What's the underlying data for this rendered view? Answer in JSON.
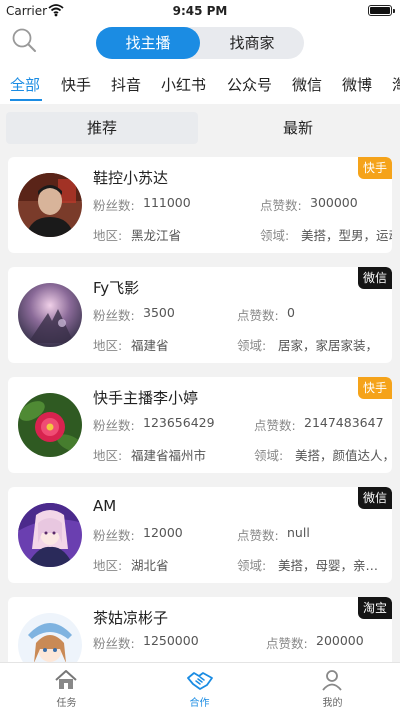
{
  "status_bar": {
    "carrier": "Carrier",
    "time": "9:45 PM"
  },
  "header": {
    "segment": [
      {
        "label": "找主播",
        "active": true
      },
      {
        "label": "找商家",
        "active": false
      }
    ]
  },
  "platform_tabs": [
    {
      "label": "全部",
      "active": true
    },
    {
      "label": "快手"
    },
    {
      "label": "抖音"
    },
    {
      "label": "小红书"
    },
    {
      "label": "公众号"
    },
    {
      "label": "微信"
    },
    {
      "label": "微博"
    },
    {
      "label": "淘"
    }
  ],
  "sort": {
    "recommend": "推荐",
    "newest": "最新"
  },
  "labels": {
    "fans": "粉丝数:",
    "likes": "点赞数:",
    "region": "地区:",
    "field": "领域:"
  },
  "cards": [
    {
      "name": "鞋控小苏达",
      "fans": "111000",
      "likes": "300000",
      "region": "黑龙江省",
      "field": "美搭，型男，运动",
      "tag": "快手",
      "tag_color": "#f5a31a"
    },
    {
      "name": "Fy飞影",
      "fans": "3500",
      "likes": "0",
      "region": "福建省",
      "field": "居家，家居家装，",
      "tag": "微信",
      "tag_color": "#151515"
    },
    {
      "name": "快手主播李小婷",
      "fans": "123656429",
      "likes": "2147483647",
      "region": "福建省福州市",
      "field": "美搭，颜值达人，",
      "tag": "快手",
      "tag_color": "#f5a31a"
    },
    {
      "name": "AM",
      "fans": "12000",
      "likes": "null",
      "region": "湖北省",
      "field": "美搭，母婴，亲…",
      "tag": "微信",
      "tag_color": "#151515"
    },
    {
      "name": "茶姑凉彬子",
      "fans": "1250000",
      "likes": "200000",
      "region": "",
      "field": "",
      "tag": "淘宝",
      "tag_color": "#151515"
    }
  ],
  "tabbar": [
    {
      "label": "任务",
      "icon": "home-icon"
    },
    {
      "label": "合作",
      "icon": "handshake-icon",
      "active": true
    },
    {
      "label": "我的",
      "icon": "person-icon"
    }
  ],
  "colors": {
    "accent": "#1b8ce3",
    "tag_orange": "#f5a31a",
    "tag_dark": "#151515"
  }
}
